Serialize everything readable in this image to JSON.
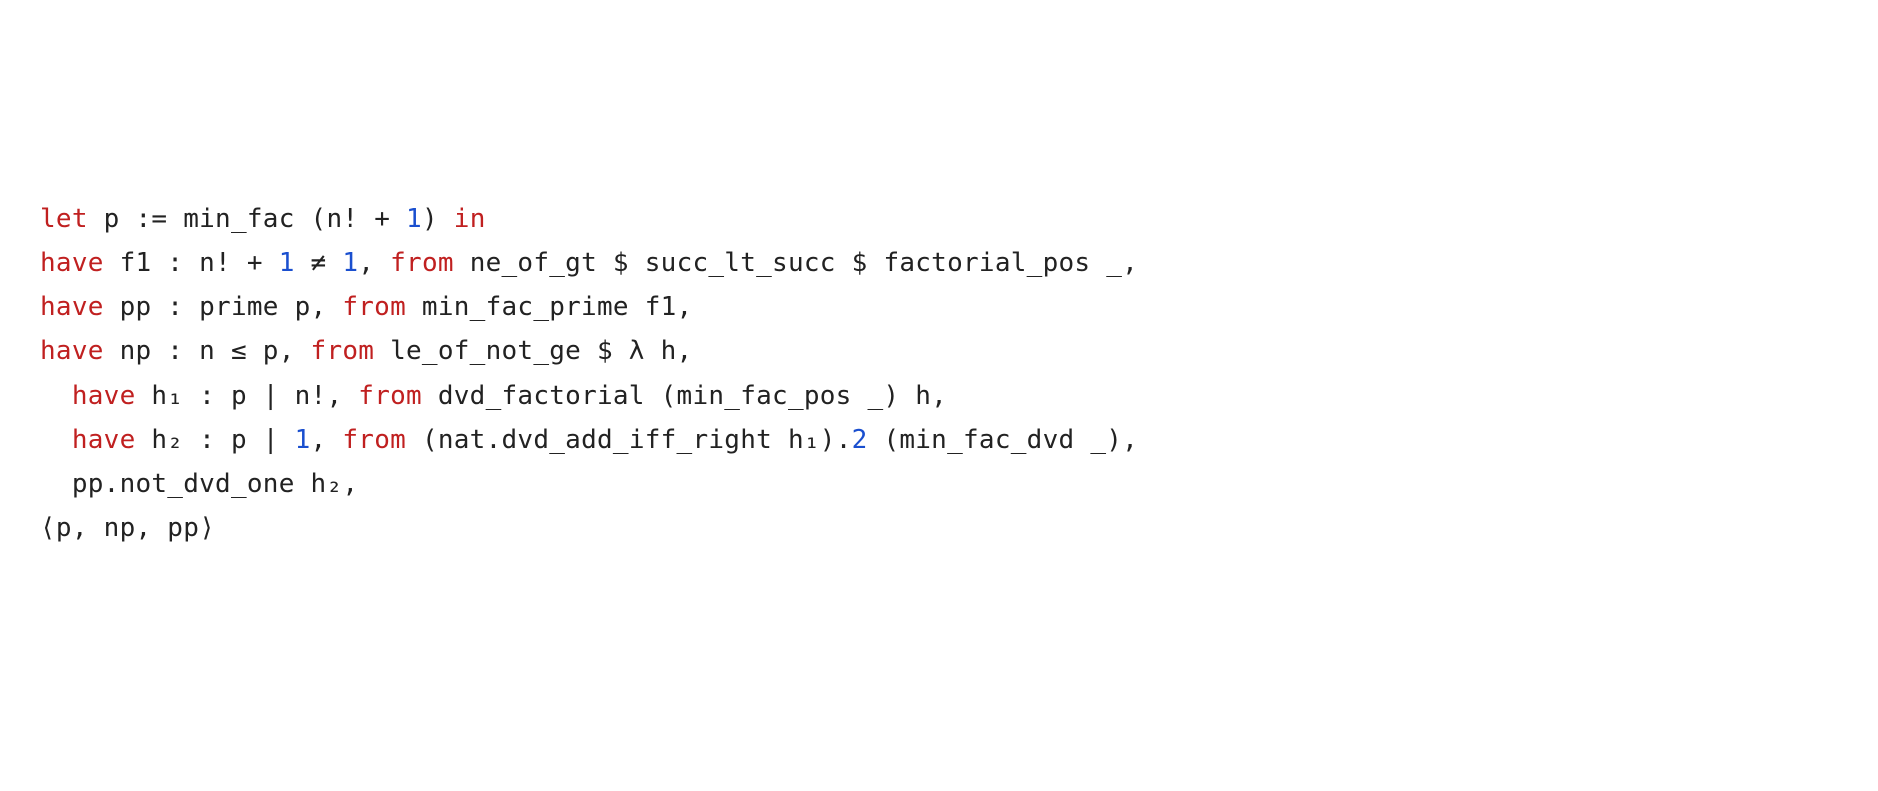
{
  "code": {
    "lines": [
      {
        "indent": "",
        "tokens": [
          {
            "t": "let",
            "c": "kw"
          },
          {
            "t": " p := min_fac (n! + ",
            "c": "txt"
          },
          {
            "t": "1",
            "c": "num"
          },
          {
            "t": ") ",
            "c": "txt"
          },
          {
            "t": "in",
            "c": "kw"
          }
        ]
      },
      {
        "indent": "",
        "tokens": [
          {
            "t": "have",
            "c": "kw"
          },
          {
            "t": " f1 : n! + ",
            "c": "txt"
          },
          {
            "t": "1",
            "c": "num"
          },
          {
            "t": " ≠ ",
            "c": "txt"
          },
          {
            "t": "1",
            "c": "num"
          },
          {
            "t": ", ",
            "c": "txt"
          },
          {
            "t": "from",
            "c": "kw"
          },
          {
            "t": " ne_of_gt $ succ_lt_succ $ factorial_pos _,",
            "c": "txt"
          }
        ]
      },
      {
        "indent": "",
        "tokens": [
          {
            "t": "have",
            "c": "kw"
          },
          {
            "t": " pp : prime p, ",
            "c": "txt"
          },
          {
            "t": "from",
            "c": "kw"
          },
          {
            "t": " min_fac_prime f1,",
            "c": "txt"
          }
        ]
      },
      {
        "indent": "",
        "tokens": [
          {
            "t": "have",
            "c": "kw"
          },
          {
            "t": " np : n ≤ p, ",
            "c": "txt"
          },
          {
            "t": "from",
            "c": "kw"
          },
          {
            "t": " le_of_not_ge $ λ h,",
            "c": "txt"
          }
        ]
      },
      {
        "indent": "  ",
        "tokens": [
          {
            "t": "have",
            "c": "kw"
          },
          {
            "t": " h₁ : p ∣ n!, ",
            "c": "txt"
          },
          {
            "t": "from",
            "c": "kw"
          },
          {
            "t": " dvd_factorial (min_fac_pos _) h,",
            "c": "txt"
          }
        ]
      },
      {
        "indent": "  ",
        "tokens": [
          {
            "t": "have",
            "c": "kw"
          },
          {
            "t": " h₂ : p ∣ ",
            "c": "txt"
          },
          {
            "t": "1",
            "c": "num"
          },
          {
            "t": ", ",
            "c": "txt"
          },
          {
            "t": "from",
            "c": "kw"
          },
          {
            "t": " (nat.dvd_add_iff_right h₁).",
            "c": "txt"
          },
          {
            "t": "2",
            "c": "num"
          },
          {
            "t": " (min_fac_dvd _),",
            "c": "txt"
          }
        ]
      },
      {
        "indent": "  ",
        "tokens": [
          {
            "t": "pp.not_dvd_one h₂,",
            "c": "txt"
          }
        ]
      },
      {
        "indent": "",
        "tokens": [
          {
            "t": "⟨p, np, pp⟩",
            "c": "txt"
          }
        ]
      }
    ]
  }
}
